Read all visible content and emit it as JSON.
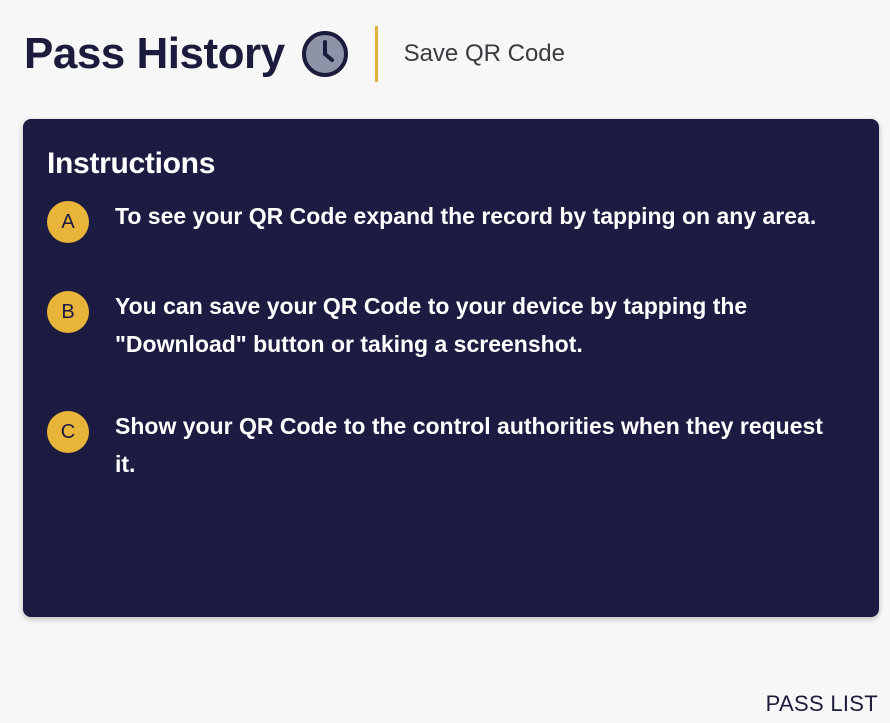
{
  "header": {
    "title": "Pass History",
    "title_icon": "clock-icon",
    "subtitle": "Save QR Code"
  },
  "instructions": {
    "title": "Instructions",
    "steps": [
      {
        "badge": "A",
        "text": "To see your QR Code expand the record by tapping on any area."
      },
      {
        "badge": "B",
        "text": "You can save your QR Code to your device by tapping the \"Download\" button or taking a screenshot."
      },
      {
        "badge": "C",
        "text": "Show your QR Code to the control authorities when they request it."
      }
    ]
  },
  "footer": {
    "pass_list_label": "PASS LIST"
  },
  "colors": {
    "card_background": "#1c1c42",
    "badge": "#e9b43a",
    "divider": "#e0b23a",
    "title_text": "#1b1c3d",
    "page_background": "#f7f7f8"
  }
}
